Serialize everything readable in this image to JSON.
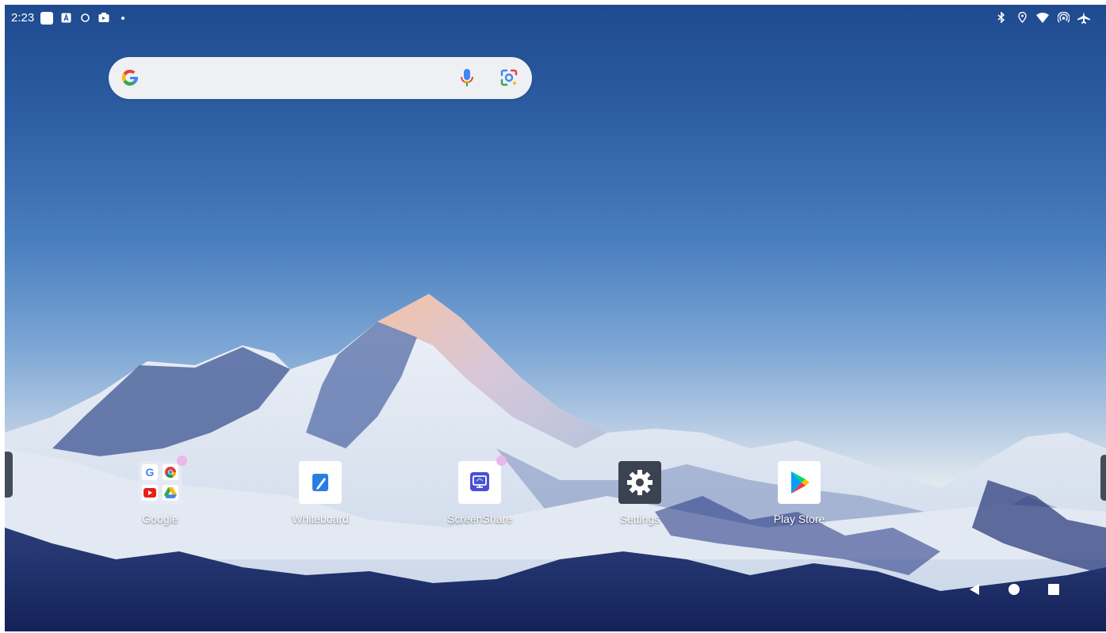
{
  "status_bar": {
    "time": "2:23",
    "left_icons": [
      "app-square-icon",
      "a-box-icon",
      "sync-circle-icon",
      "camera-box-icon",
      "dot-icon"
    ],
    "right_icons": [
      "bluetooth-icon",
      "location-icon",
      "wifi-icon",
      "hotspot-icon",
      "airplane-icon"
    ]
  },
  "search_bar": {
    "logo": "G",
    "icons": [
      "google-logo-icon",
      "mic-icon",
      "lens-icon"
    ]
  },
  "apps": [
    {
      "label": "Google",
      "icon": "google-folder-icon",
      "badge": true
    },
    {
      "label": "Whiteboard",
      "icon": "whiteboard-icon",
      "badge": false
    },
    {
      "label": "ScreenShare",
      "icon": "screenshare-icon",
      "badge": true
    },
    {
      "label": "Settings",
      "icon": "gear-icon",
      "badge": false
    },
    {
      "label": "Play Store",
      "icon": "play-store-icon",
      "badge": false
    }
  ],
  "nav_bar": {
    "icons": [
      "back-icon",
      "home-icon",
      "recents-icon"
    ]
  },
  "colors": {
    "sky_top": "#1f4a8f",
    "sky_bottom": "#e9edf3",
    "badge": "#e9b7e8",
    "settings_bg": "#3b4250"
  }
}
